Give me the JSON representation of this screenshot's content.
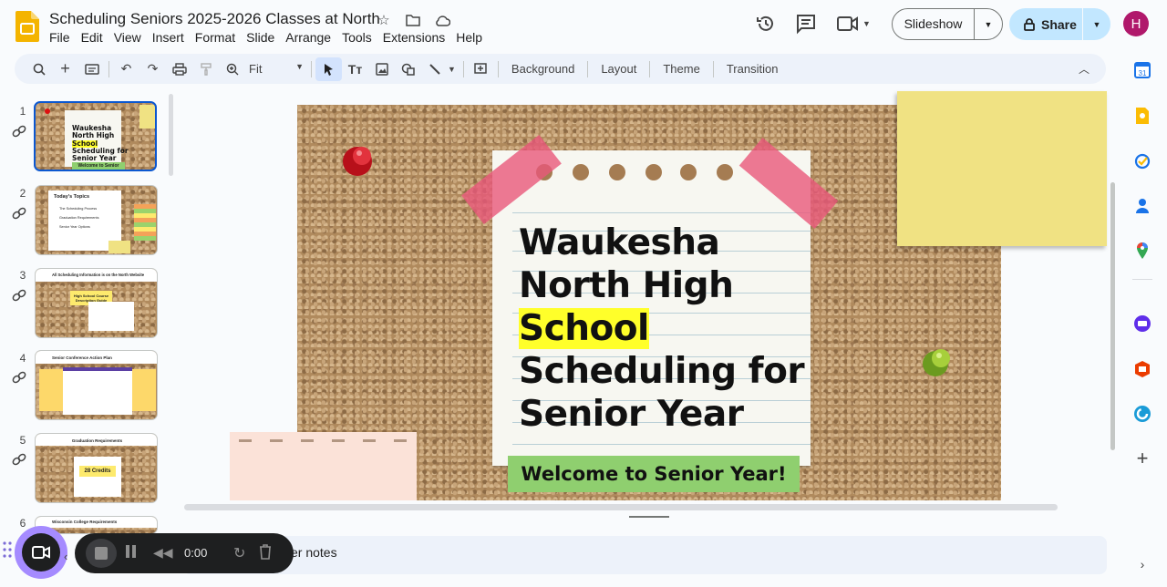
{
  "doc": {
    "title": "Scheduling Seniors 2025-2026 Classes at North"
  },
  "menu": [
    "File",
    "Edit",
    "View",
    "Insert",
    "Format",
    "Slide",
    "Arrange",
    "Tools",
    "Extensions",
    "Help"
  ],
  "header": {
    "slideshow_label": "Slideshow",
    "share_label": "Share",
    "avatar_initial": "H"
  },
  "toolbar": {
    "zoom_label": "Fit",
    "background_label": "Background",
    "layout_label": "Layout",
    "theme_label": "Theme",
    "transition_label": "Transition"
  },
  "slides": [
    {
      "num": "1",
      "lines": [
        "Waukesha",
        "North High",
        "School",
        "Scheduling for",
        "Senior Year"
      ],
      "footer": "Welcome to Senior Year!"
    },
    {
      "num": "2",
      "heading": "Today's Topics",
      "items": [
        "The Scheduling Process",
        "Graduation Requirements",
        "Senior Year Options"
      ]
    },
    {
      "num": "3",
      "heading": "All Scheduling Information is on the North Website",
      "box": "High School Course Description Guide"
    },
    {
      "num": "4",
      "heading": "Senior Conference Action Plan"
    },
    {
      "num": "5",
      "heading": "Graduation Requirements",
      "box": "28 Credits"
    },
    {
      "num": "6",
      "heading": "Wisconsin College Requirements"
    }
  ],
  "canvas": {
    "title_lines": [
      "Waukesha",
      "North High",
      "School",
      "Scheduling for",
      "Senior Year"
    ],
    "highlighted_word": "School",
    "welcome": "Welcome to Senior Year!"
  },
  "notes": {
    "label": "ker notes"
  },
  "recorder": {
    "time": "0:00"
  },
  "colors": {
    "accent": "#0b57d0",
    "share_bg": "#c2e7ff",
    "avatar": "#b0186b",
    "highlight": "#ffff2a",
    "banner": "#8fcf6f",
    "tape": "#e8587a"
  }
}
